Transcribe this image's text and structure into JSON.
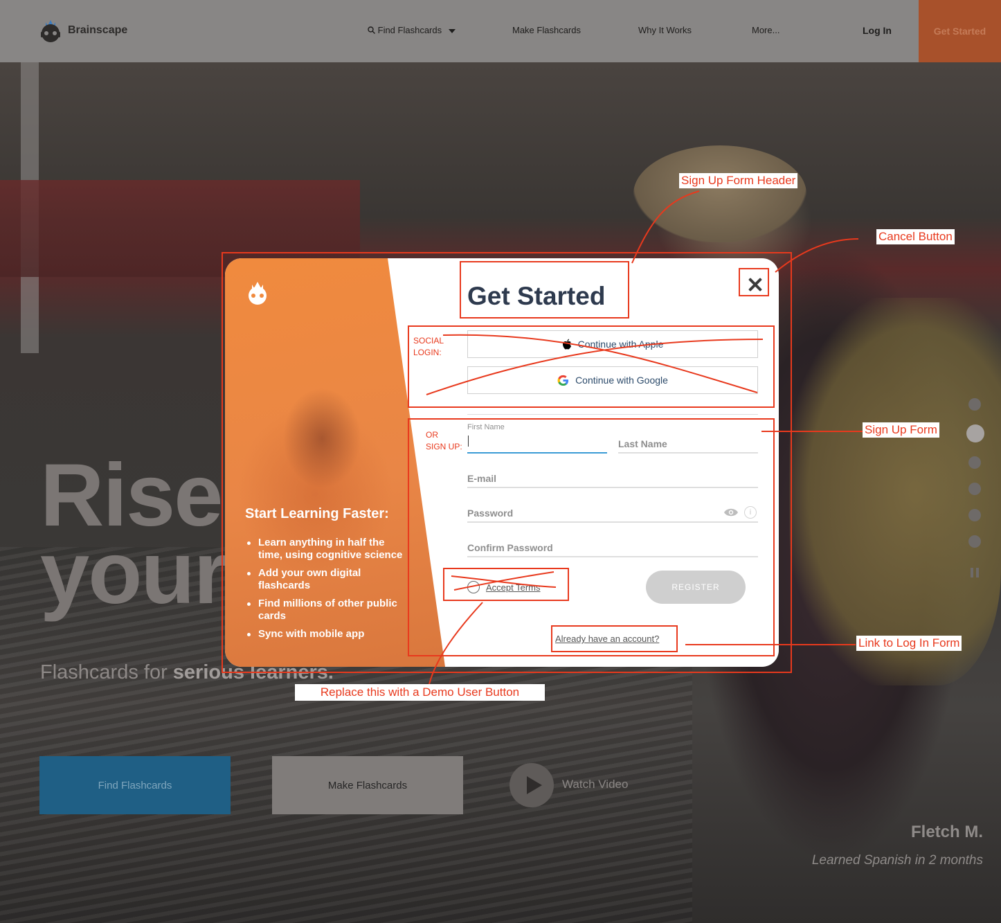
{
  "nav": {
    "brand": "Brainscape",
    "find_flashcards": "Find Flashcards",
    "make_flashcards": "Make Flashcards",
    "why_it_works": "Why It Works",
    "more": "More...",
    "log_in": "Log In",
    "get_started": "Get Started"
  },
  "hero": {
    "title_line1": "Rise",
    "title_line2": "your",
    "subtitle_prefix": "Flashcards for ",
    "subtitle_bold": "serious learners.",
    "find_button": "Find Flashcards",
    "make_button": "Make Flashcards",
    "watch_video": "Watch Video",
    "testimonial_name": "Fletch M.",
    "testimonial_text": "Learned Spanish in 2 months"
  },
  "modal": {
    "title": "Get Started",
    "left": {
      "heading": "Start Learning Faster:",
      "benefits": [
        "Learn anything in half the time, using cognitive science",
        "Add your own digital flashcards",
        "Find millions of other public cards",
        "Sync with mobile app"
      ]
    },
    "social": {
      "apple": "Continue with Apple",
      "google": "Continue with Google"
    },
    "form": {
      "first_name_label": "First Name",
      "last_name": "Last Name",
      "email": "E-mail",
      "password": "Password",
      "confirm_password": "Confirm Password",
      "accept_terms": "Accept Terms",
      "register": "REGISTER",
      "already_account": "Already have an account?"
    }
  },
  "annotations": {
    "header": "Sign Up Form Header",
    "cancel": "Cancel Button",
    "social_line1": "SOCIAL",
    "social_line2": "LOGIN:",
    "or_line1": "OR",
    "or_line2": "SIGN UP:",
    "signup_form": "Sign Up Form",
    "login_link": "Link to Log In Form",
    "demo": "Replace this with a Demo User Button"
  },
  "colors": {
    "accent_orange": "#f08a3e",
    "annotation_red": "#e8391d",
    "nav_cta": "#a8512b",
    "title_navy": "#2e3a4e"
  }
}
